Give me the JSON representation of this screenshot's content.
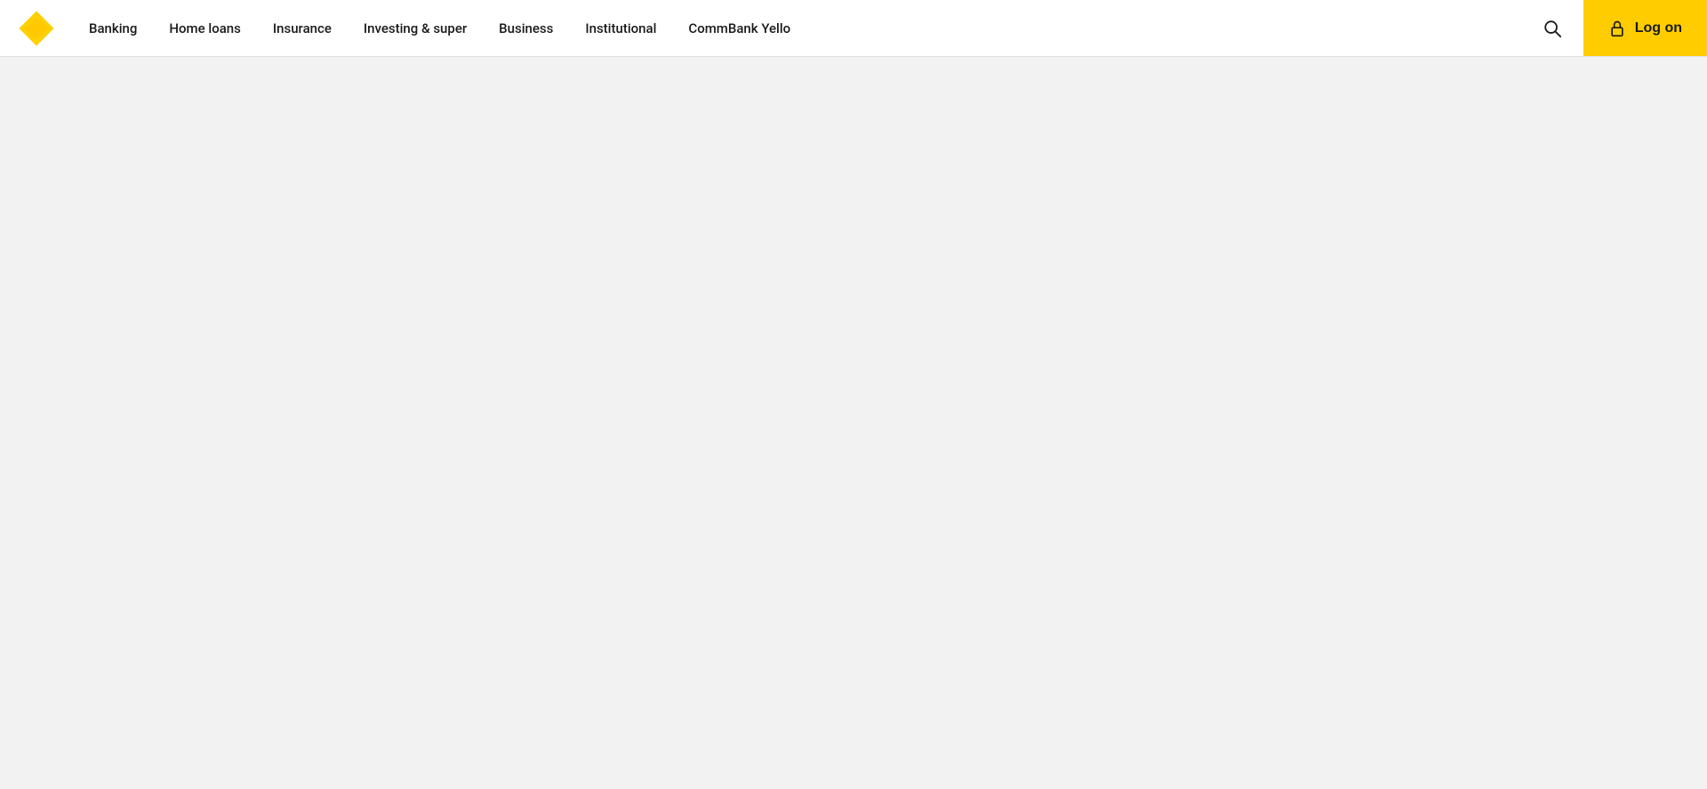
{
  "header": {
    "logo_alt": "CommBank logo",
    "nav": {
      "items": [
        {
          "label": "Banking",
          "href": "#"
        },
        {
          "label": "Home loans",
          "href": "#"
        },
        {
          "label": "Insurance",
          "href": "#"
        },
        {
          "label": "Investing & super",
          "href": "#"
        },
        {
          "label": "Business",
          "href": "#"
        },
        {
          "label": "Institutional",
          "href": "#"
        },
        {
          "label": "CommBank Yello",
          "href": "#"
        }
      ]
    },
    "search_aria": "Search",
    "logon_label": "Log on",
    "brand_color": "#ffcc00",
    "text_color": "#1a1a1a"
  }
}
